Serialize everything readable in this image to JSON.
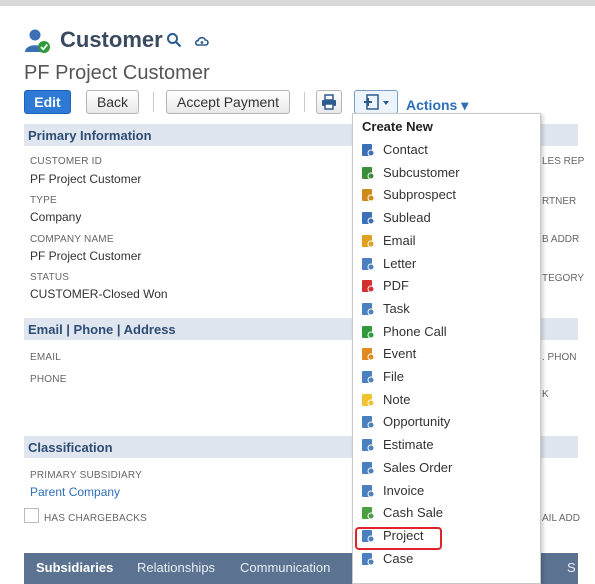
{
  "header": {
    "title": "Customer",
    "record_name": "PF Project Customer"
  },
  "toolbar": {
    "edit_label": "Edit",
    "back_label": "Back",
    "accept_payment_label": "Accept Payment",
    "actions_label": "Actions ▾"
  },
  "sections": {
    "primary": "Primary Information",
    "contact": "Email | Phone | Address",
    "classification": "Classification"
  },
  "fields": {
    "customer_id_label": "CUSTOMER ID",
    "customer_id_value": "PF Project Customer",
    "type_label": "TYPE",
    "type_value": "Company",
    "company_name_label": "COMPANY NAME",
    "company_name_value": "PF Project Customer",
    "status_label": "STATUS",
    "status_value": "CUSTOMER-Closed Won",
    "email_label": "EMAIL",
    "phone_label": "PHONE",
    "primary_subsidiary_label": "PRIMARY SUBSIDIARY",
    "primary_subsidiary_value": "Parent Company",
    "has_chargebacks_label": "HAS CHARGEBACKS"
  },
  "right_labels": {
    "r1": "LES REP",
    "r2": "RTNER",
    "r3": "B ADDR",
    "r4": "TEGORY",
    "r5": ". PHON",
    "r6": "K",
    "r7": "AIL ADD"
  },
  "tabs": {
    "subsidiaries": "Subsidiaries",
    "relationships": "Relationships",
    "communication": "Communication",
    "s": "S"
  },
  "menu": {
    "header": "Create New",
    "items": [
      {
        "label": "Contact",
        "icon": "contact-icon",
        "color": "#3b6fb6"
      },
      {
        "label": "Subcustomer",
        "icon": "subcustomer-icon",
        "color": "#3b8f3b"
      },
      {
        "label": "Subprospect",
        "icon": "subprospect-icon",
        "color": "#d08a1a"
      },
      {
        "label": "Sublead",
        "icon": "sublead-icon",
        "color": "#3b6fb6"
      },
      {
        "label": "Email",
        "icon": "email-icon",
        "color": "#e0a020"
      },
      {
        "label": "Letter",
        "icon": "letter-icon",
        "color": "#4a7fc0"
      },
      {
        "label": "PDF",
        "icon": "pdf-icon",
        "color": "#d23030"
      },
      {
        "label": "Task",
        "icon": "task-icon",
        "color": "#4a7fc0"
      },
      {
        "label": "Phone Call",
        "icon": "phone-icon",
        "color": "#2f9a3a"
      },
      {
        "label": "Event",
        "icon": "event-icon",
        "color": "#e08a20"
      },
      {
        "label": "File",
        "icon": "file-icon",
        "color": "#4a7fc0"
      },
      {
        "label": "Note",
        "icon": "note-icon",
        "color": "#f2c230"
      },
      {
        "label": "Opportunity",
        "icon": "opportunity-icon",
        "color": "#4a7fc0"
      },
      {
        "label": "Estimate",
        "icon": "estimate-icon",
        "color": "#4a7fc0"
      },
      {
        "label": "Sales Order",
        "icon": "sales-order-icon",
        "color": "#4a7fc0"
      },
      {
        "label": "Invoice",
        "icon": "invoice-icon",
        "color": "#4a7fc0"
      },
      {
        "label": "Cash Sale",
        "icon": "cash-sale-icon",
        "color": "#4aa040"
      },
      {
        "label": "Project",
        "icon": "project-icon",
        "color": "#4a7fc0"
      },
      {
        "label": "Case",
        "icon": "case-icon",
        "color": "#4a7fc0"
      }
    ]
  },
  "colors": {
    "accent": "#2c79d6",
    "section_bg": "#dfe6ef",
    "tabbar_bg": "#5b7390",
    "highlight": "#e0222b"
  }
}
